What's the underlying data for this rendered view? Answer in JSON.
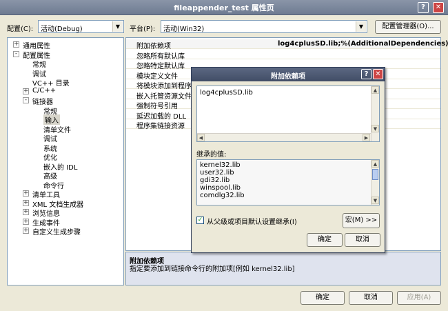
{
  "window": {
    "title": "fileappender_test 属性页",
    "help": "?",
    "close": "✕"
  },
  "config": {
    "config_label": "配置(C):",
    "config_value": "活动(Debug)",
    "platform_label": "平台(P):",
    "platform_value": "活动(Win32)",
    "manager_button": "配置管理器(O)..."
  },
  "tree": [
    {
      "label": "通用属性",
      "depth": 0,
      "expander": "+"
    },
    {
      "label": "配置属性",
      "depth": 0,
      "expander": "-"
    },
    {
      "label": "常规",
      "depth": 1,
      "expander": ""
    },
    {
      "label": "调试",
      "depth": 1,
      "expander": ""
    },
    {
      "label": "VC++ 目录",
      "depth": 1,
      "expander": ""
    },
    {
      "label": "C/C++",
      "depth": 1,
      "expander": "+"
    },
    {
      "label": "链接器",
      "depth": 1,
      "expander": "-"
    },
    {
      "label": "常规",
      "depth": 2,
      "expander": ""
    },
    {
      "label": "输入",
      "depth": 2,
      "expander": "",
      "selected": true
    },
    {
      "label": "清单文件",
      "depth": 2,
      "expander": ""
    },
    {
      "label": "调试",
      "depth": 2,
      "expander": ""
    },
    {
      "label": "系统",
      "depth": 2,
      "expander": ""
    },
    {
      "label": "优化",
      "depth": 2,
      "expander": ""
    },
    {
      "label": "嵌入的 IDL",
      "depth": 2,
      "expander": ""
    },
    {
      "label": "高级",
      "depth": 2,
      "expander": ""
    },
    {
      "label": "命令行",
      "depth": 2,
      "expander": ""
    },
    {
      "label": "清单工具",
      "depth": 1,
      "expander": "+"
    },
    {
      "label": "XML 文档生成器",
      "depth": 1,
      "expander": "+"
    },
    {
      "label": "浏览信息",
      "depth": 1,
      "expander": "+"
    },
    {
      "label": "生成事件",
      "depth": 1,
      "expander": "+"
    },
    {
      "label": "自定义生成步骤",
      "depth": 1,
      "expander": "+"
    }
  ],
  "properties": [
    {
      "name": "附加依赖项",
      "value": "log4cplusSD.lib;%(AdditionalDependencies)"
    },
    {
      "name": "忽略所有默认库",
      "value": ""
    },
    {
      "name": "忽略特定默认库",
      "value": ""
    },
    {
      "name": "模块定义文件",
      "value": ""
    },
    {
      "name": "将模块添加到程序",
      "value": ""
    },
    {
      "name": "嵌入托管资源文件",
      "value": ""
    },
    {
      "name": "强制符号引用",
      "value": ""
    },
    {
      "name": "延迟加载的 DLL",
      "value": ""
    },
    {
      "name": "程序集链接资源",
      "value": ""
    }
  ],
  "description": {
    "title": "附加依赖项",
    "text": "指定要添加到链接命令行的附加项[例如 kernel32.lib]"
  },
  "dialog": {
    "title": "附加依赖项",
    "help": "?",
    "close": "✕",
    "edit_value": "log4cplusSD.lib",
    "inherited_label": "继承的值:",
    "inherited": [
      "kernel32.lib",
      "user32.lib",
      "gdi32.lib",
      "winspool.lib",
      "comdlg32.lib"
    ],
    "inherit_checkbox": "从父级或项目默认设置继承(I)",
    "macro_button": "宏(M) >>",
    "ok": "确定",
    "cancel": "取消"
  },
  "footer": {
    "ok": "确定",
    "cancel": "取消",
    "apply": "应用(A)"
  }
}
